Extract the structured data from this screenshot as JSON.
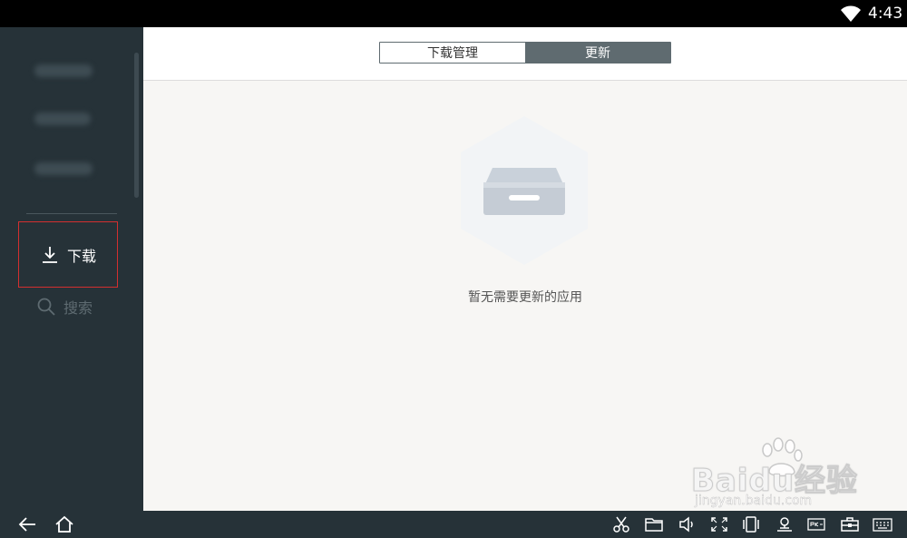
{
  "status_bar": {
    "time": "4:43"
  },
  "sidebar": {
    "items": [
      {
        "label": "下载"
      },
      {
        "label": "搜索"
      }
    ]
  },
  "tabs": [
    {
      "label": "下载管理",
      "active": false
    },
    {
      "label": "更新",
      "active": true
    }
  ],
  "empty_state": {
    "message": "暂无需要更新的应用"
  },
  "watermark": {
    "brand": "Baidu经验",
    "url": "jingyan.baidu.com"
  },
  "colors": {
    "sidebar_bg": "#263238",
    "tab_active_bg": "#5f6b70",
    "highlight_border": "#d32f2f",
    "content_bg": "#f7f6f4"
  },
  "system_nav_icons": [
    "back-icon",
    "home-icon",
    "scissors-icon",
    "folder-icon",
    "volume-icon",
    "fullscreen-icon",
    "rotate-icon",
    "location-icon",
    "apk-icon",
    "toolbox-icon",
    "keyboard-icon"
  ]
}
